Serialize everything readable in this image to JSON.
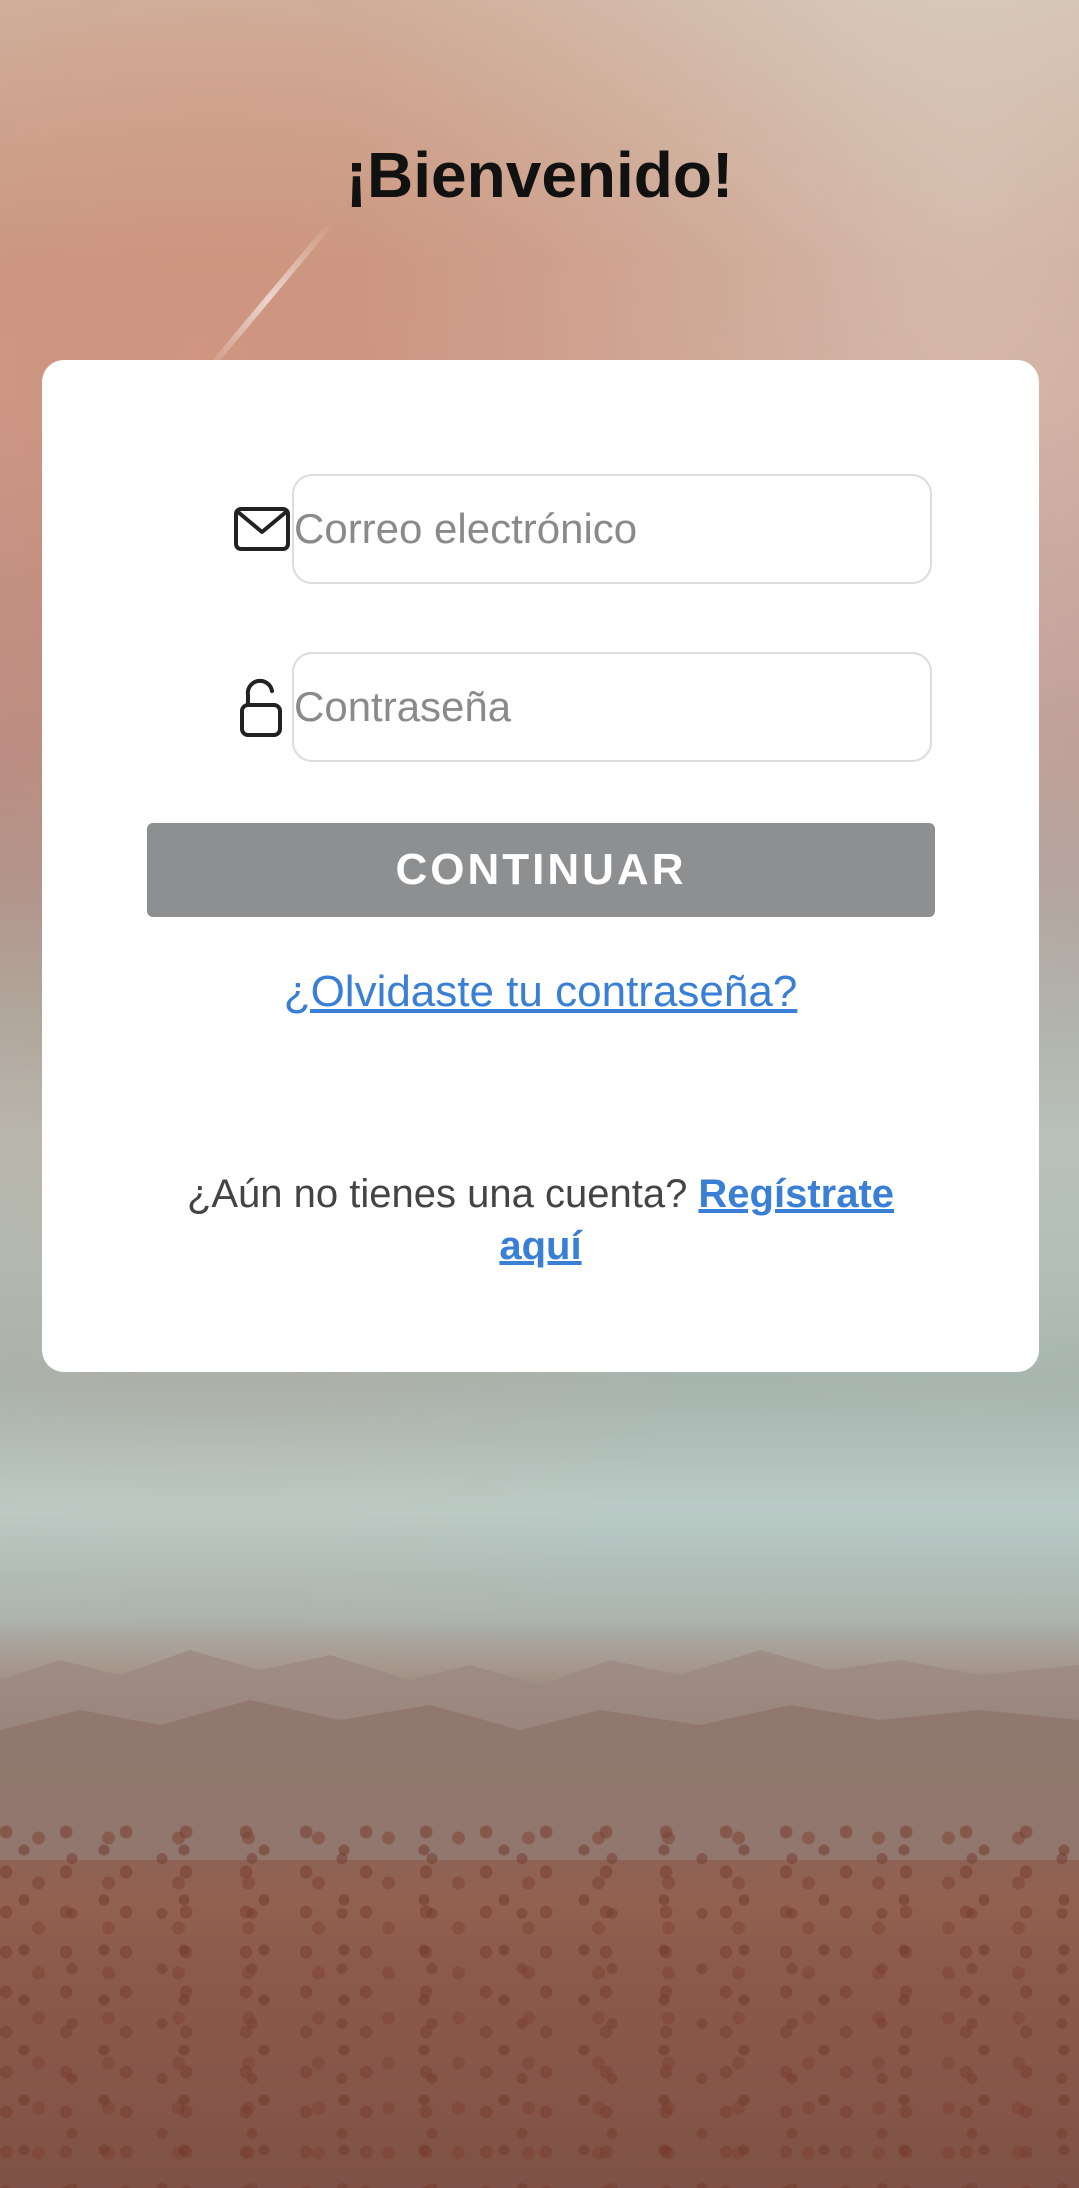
{
  "welcome_title": "¡Bienvenido!",
  "login_form": {
    "email": {
      "placeholder": "Correo electrónico",
      "value": "",
      "icon": "envelope-icon"
    },
    "password": {
      "placeholder": "Contraseña",
      "value": "",
      "icon": "unlocked-padlock-icon"
    },
    "continue_label": "CONTINUAR",
    "forgot_password_label": "¿Olvidaste tu contraseña?",
    "no_account_text": "¿Aún no tienes una cuenta?",
    "register_label": "Regístrate aquí"
  },
  "colors": {
    "button_disabled": "#8e8f90",
    "link": "#3a7fd6",
    "card": "#ffffff"
  }
}
